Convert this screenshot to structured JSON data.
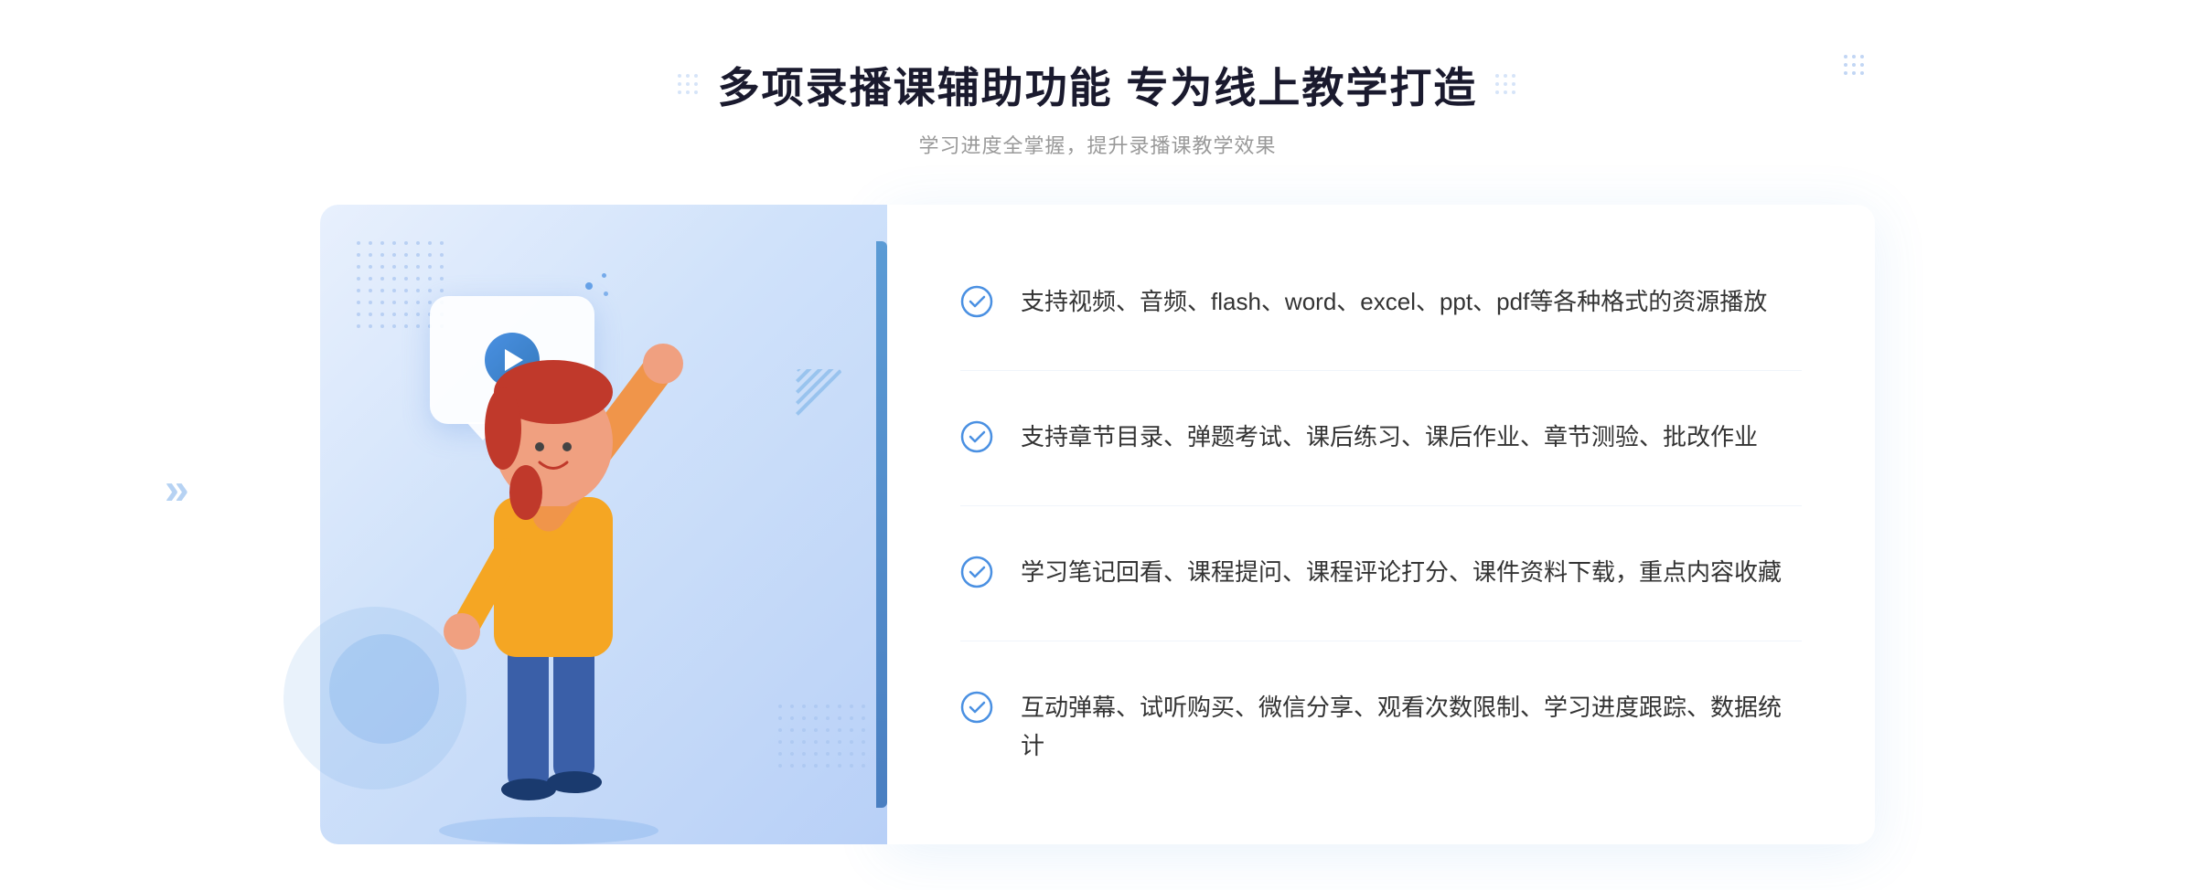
{
  "header": {
    "title": "多项录播课辅助功能 专为线上教学打造",
    "subtitle": "学习进度全掌握，提升录播课教学效果"
  },
  "features": [
    {
      "id": "feature-1",
      "text": "支持视频、音频、flash、word、excel、ppt、pdf等各种格式的资源播放"
    },
    {
      "id": "feature-2",
      "text": "支持章节目录、弹题考试、课后练习、课后作业、章节测验、批改作业"
    },
    {
      "id": "feature-3",
      "text": "学习笔记回看、课程提问、课程评论打分、课件资料下载，重点内容收藏"
    },
    {
      "id": "feature-4",
      "text": "互动弹幕、试听购买、微信分享、观看次数限制、学习进度跟踪、数据统计"
    }
  ],
  "decoration": {
    "chevron_text": "»",
    "check_color": "#4a90e2",
    "title_color": "#1a1a2e",
    "subtitle_color": "#999999"
  }
}
